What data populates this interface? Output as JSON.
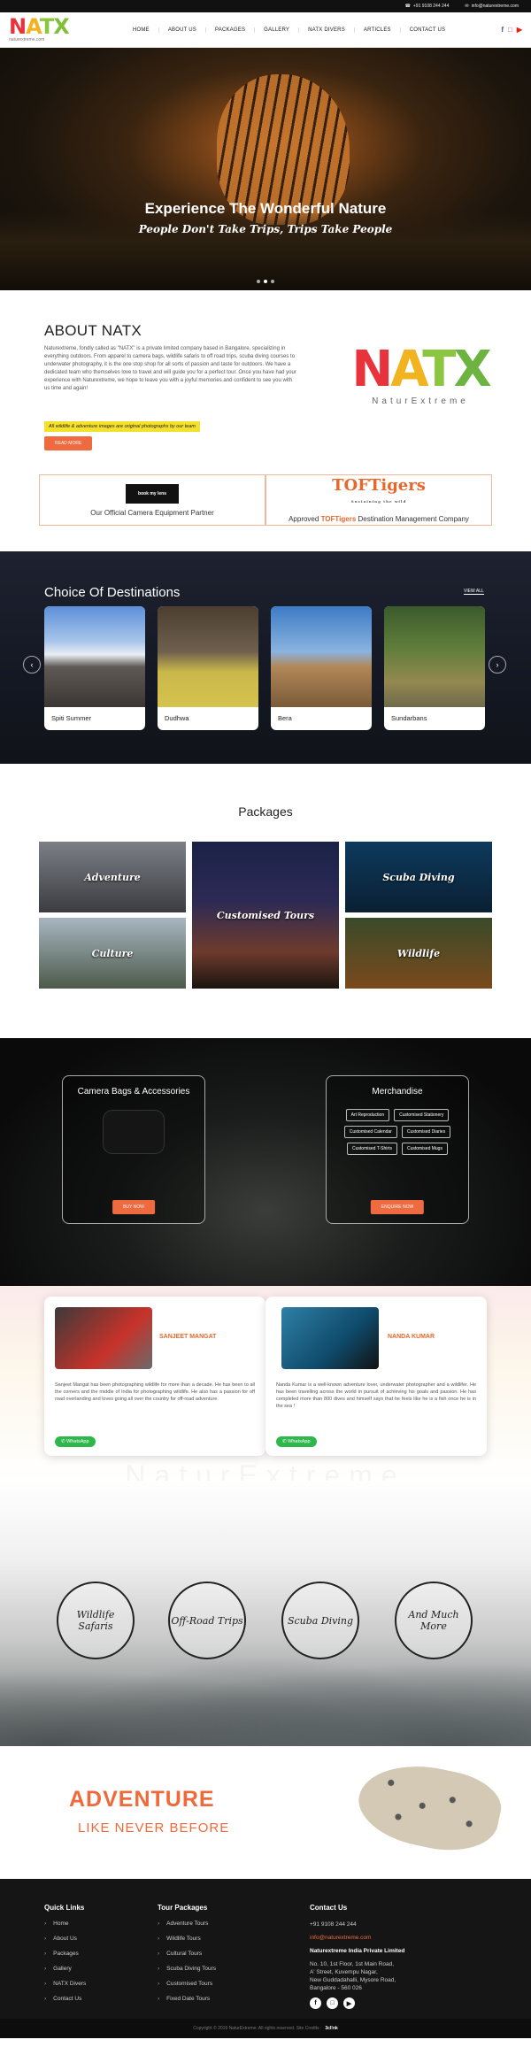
{
  "topbar": {
    "phone": "+91 9108 244 244",
    "email": "info@naturextreme.com"
  },
  "brand": {
    "logo_text": "NATX",
    "logo_sub": "naturextreme.com",
    "big_sub": "NaturExtreme"
  },
  "nav": {
    "items": [
      "HOME",
      "ABOUT US",
      "PACKAGES",
      "GALLERY",
      "NATX DIVERS",
      "ARTICLES",
      "CONTACT US"
    ]
  },
  "hero": {
    "title": "Experience The Wonderful Nature",
    "subtitle": "People Don't Take Trips, Trips Take People"
  },
  "about": {
    "heading": "ABOUT NATX",
    "body": "Naturextreme, fondly called as \"NATX\" is a private limited company based in Bangalore, specializing in everything outdoors. From apparel to camera bags, wildlife safaris to off road trips, scuba diving courses to underwater photography, it is the one stop shop for all sorts of passion and taste for outdoors. We have a dedicated team who themselves love to travel and will guide you for a perfect tour. Once you have had your experience with Naturextreme, we hope to leave you with a joyful memories and confident to see you with us time and again!",
    "note": "All wildlife & adventure images are original photographs by our team",
    "button": "READ MORE"
  },
  "partners": {
    "left_logo": "book my lens",
    "left_caption": "Our Official Camera Equipment Partner",
    "right_logo": "TOFTigers",
    "right_tagline": "Sustaining the wild",
    "right_caption_pre": "Approved",
    "right_caption_brand": "TOFTigers",
    "right_caption_post": "Destination Management Company"
  },
  "destinations": {
    "heading": "Choice Of Destinations",
    "view_all": "VIEW ALL",
    "cards": [
      "Spiti Summer",
      "Dudhwa",
      "Bera",
      "Sundarbans"
    ]
  },
  "packages": {
    "heading": "Packages",
    "items": [
      "Adventure",
      "Customised Tours",
      "Scuba Diving",
      "Culture",
      "Wildlife"
    ]
  },
  "shop": {
    "left_title": "Camera Bags & Accessories",
    "left_button": "BUY NOW",
    "right_title": "Merchandise",
    "tags": [
      "Art Reproduction",
      "Customised Stationery",
      "Customised Calendar",
      "Customised Diaries",
      "Customised T-Shirts",
      "Customised Mugs"
    ],
    "right_button": "ENQUIRE NOW"
  },
  "team": {
    "members": [
      {
        "name": "SANJEET MANGAT",
        "bio": "Sanjeet Mangat has been photographing wildlife for more than a decade. He has been to all the corners and the middle of India for photographing wildlife. He also has a passion for off road overlanding and loves going all over the country for off-road adventure.",
        "button": "WhatsApp"
      },
      {
        "name": "NANDA KUMAR",
        "bio": "Nanda Kumar is a well-known adventure lover, underwater photographer and a wildlifer. He has been travelling across the world in pursuit of achieving his goals and passion. He has completed more than 800 dives and himself says that he feels like he is a fish once he is in the sea !",
        "button": "WhatsApp"
      }
    ]
  },
  "experiences": {
    "items": [
      "Wildlife Safaris",
      "Off-Road Trips",
      "Scuba Diving",
      "And Much More"
    ]
  },
  "adventure": {
    "title": "ADVENTURE",
    "subtitle": "LIKE NEVER BEFORE"
  },
  "footer": {
    "quick_title": "Quick Links",
    "quick_links": [
      "Home",
      "About Us",
      "Packages",
      "Gallery",
      "NATX Divers",
      "Contact Us"
    ],
    "tours_title": "Tour Packages",
    "tours": [
      "Adventure Tours",
      "Wildlife Tours",
      "Cultural Tours",
      "Scuba Diving Tours",
      "Customised Tours",
      "Fixed Date Tours"
    ],
    "contact_title": "Contact Us",
    "phone": "+91 9108 244 244",
    "email": "info@naturextreme.com",
    "company": "Naturextreme India Private Limited",
    "address": [
      "No. 10, 1st Floor, 1st Main Road,",
      "A' Street, Kuvempu Nagar,",
      "New Guddadahalli, Mysore Road,",
      "Bangalore - 560 026"
    ],
    "copyright": "Copyright © 2019 NaturExtreme. All rights reserved. Site Credits :",
    "credit": "3cl!nk"
  },
  "colors": {
    "accent": "#f06a3f",
    "dark": "#151515"
  }
}
